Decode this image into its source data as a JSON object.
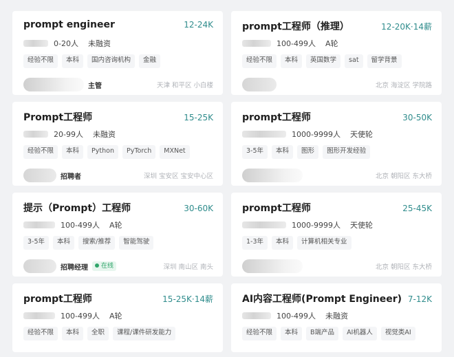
{
  "jobs": [
    {
      "title": "prompt engineer",
      "salary": "12-24K",
      "company_size": "0-20人",
      "funding": "未融资",
      "tags": [
        "经验不限",
        "本科",
        "国内咨询机构",
        "金融"
      ],
      "recruiter": "主管",
      "online": "",
      "location": "天津 和平区 小白楼"
    },
    {
      "title": "prompt工程师（推理）",
      "salary": "12-20K·14薪",
      "company_size": "100-499人",
      "funding": "A轮",
      "tags": [
        "经验不限",
        "本科",
        "英国数学",
        "sat",
        "留学背景"
      ],
      "recruiter": "",
      "online": "",
      "location": "北京 海淀区 学院路"
    },
    {
      "title": "Prompt工程师",
      "salary": "15-25K",
      "company_size": "20-99人",
      "funding": "未融资",
      "tags": [
        "经验不限",
        "本科",
        "Python",
        "PyTorch",
        "MXNet"
      ],
      "recruiter": "招聘者",
      "online": "",
      "location": "深圳 宝安区 宝安中心区"
    },
    {
      "title": "prompt工程师",
      "salary": "30-50K",
      "company_size": "1000-9999人",
      "funding": "天使轮",
      "tags": [
        "3-5年",
        "本科",
        "图形",
        "图形开发经验"
      ],
      "recruiter": "",
      "online": "",
      "location": "北京 朝阳区 东大桥"
    },
    {
      "title": "提示（Prompt）工程师",
      "salary": "30-60K",
      "company_size": "100-499人",
      "funding": "A轮",
      "tags": [
        "3-5年",
        "本科",
        "搜索/推荐",
        "智能驾驶"
      ],
      "recruiter": "招聘经理",
      "online": "在线",
      "location": "深圳 南山区 南头"
    },
    {
      "title": "prompt工程师",
      "salary": "25-45K",
      "company_size": "1000-9999人",
      "funding": "天使轮",
      "tags": [
        "1-3年",
        "本科",
        "计算机相关专业"
      ],
      "recruiter": "",
      "online": "",
      "location": "北京 朝阳区 东大桥"
    },
    {
      "title": "prompt工程师",
      "salary": "15-25K·14薪",
      "company_size": "100-499人",
      "funding": "A轮",
      "tags": [
        "经验不限",
        "本科",
        "全职",
        "课程/课件研发能力"
      ],
      "recruiter": "",
      "online": "",
      "location": ""
    },
    {
      "title": "AI内容工程师(Prompt Engineer)",
      "salary": "7-12K",
      "company_size": "100-499人",
      "funding": "未融资",
      "tags": [
        "经验不限",
        "本科",
        "B端产品",
        "AI机器人",
        "视觉类AI"
      ],
      "recruiter": "",
      "online": "",
      "location": ""
    }
  ]
}
